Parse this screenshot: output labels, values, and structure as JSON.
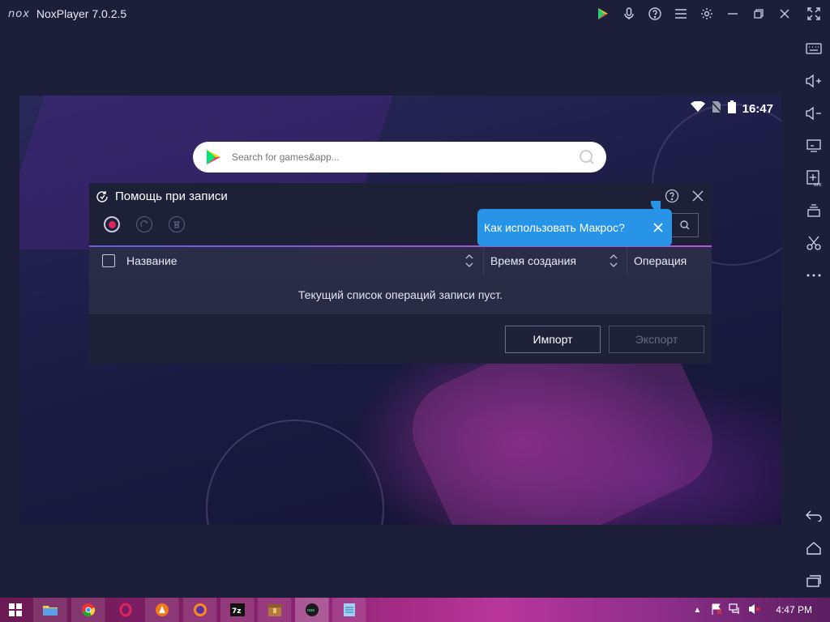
{
  "titlebar": {
    "logo": "nox",
    "title": "NoxPlayer 7.0.2.5"
  },
  "android": {
    "clock": "16:47",
    "search_placeholder": "Search for games&app..."
  },
  "dialog": {
    "title": "Помощь при записи",
    "table": {
      "columns": [
        "Название",
        "Время создания",
        "Операция"
      ],
      "empty_message": "Текущий список операций записи пуст."
    },
    "import_label": "Импорт",
    "export_label": "Экспорт"
  },
  "tooltip": {
    "text": "Как использовать Макрос?"
  },
  "taskbar": {
    "time": "4:47 PM"
  },
  "colors": {
    "accent_blue": "#2894e8",
    "record_red": "#e0245e",
    "taskbar_magenta": "#b8369a",
    "dialog_bg": "#242540"
  }
}
